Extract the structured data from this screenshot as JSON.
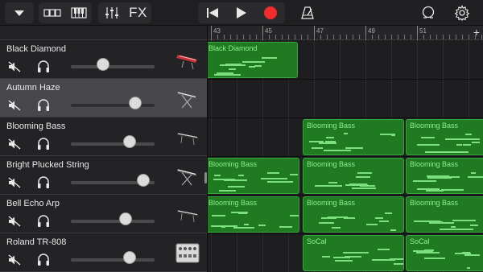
{
  "toolbar": {
    "fx_label": "FX"
  },
  "tracks": [
    {
      "name": "Black Diamond",
      "volume": 0.38,
      "instrument": "keyboard-red"
    },
    {
      "name": "Autumn Haze",
      "volume": 0.77,
      "instrument": "keyboard-stand"
    },
    {
      "name": "Blooming Bass",
      "volume": 0.7,
      "instrument": "keyboard-dark"
    },
    {
      "name": "Bright Plucked String",
      "volume": 0.87,
      "instrument": "keyboard-stand"
    },
    {
      "name": "Bell Echo Arp",
      "volume": 0.65,
      "instrument": "keyboard-dark"
    },
    {
      "name": "Roland TR-808",
      "volume": 0.7,
      "instrument": "drum-machine"
    }
  ],
  "ruler": {
    "bars": [
      "43",
      "45",
      "47",
      "49",
      "51"
    ]
  },
  "regions": [
    {
      "lane": 0,
      "label": "Black Diamond"
    },
    {
      "lane": 2,
      "label": "Blooming Bass"
    },
    {
      "lane": 2,
      "label": "Blooming Bass"
    },
    {
      "lane": 3,
      "label": "Blooming Bass"
    },
    {
      "lane": 3,
      "label": "Blooming Bass"
    },
    {
      "lane": 3,
      "label": "Blooming Bass"
    },
    {
      "lane": 4,
      "label": "Blooming Bass"
    },
    {
      "lane": 4,
      "label": "Blooming Bass"
    },
    {
      "lane": 4,
      "label": "Blooming Bass"
    },
    {
      "lane": 5,
      "label": "SoCal"
    },
    {
      "lane": 5,
      "label": "SoCal"
    }
  ]
}
